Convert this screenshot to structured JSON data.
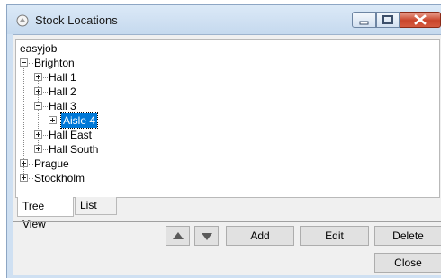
{
  "window": {
    "title": "Stock Locations"
  },
  "tree": {
    "root": "easyjob",
    "items": [
      {
        "label": "Brighton",
        "state": "expanded"
      },
      {
        "label": "Hall 1",
        "state": "collapsed"
      },
      {
        "label": "Hall 2",
        "state": "collapsed"
      },
      {
        "label": "Hall 3",
        "state": "expanded"
      },
      {
        "label": "Aisle 4",
        "state": "collapsed",
        "selected": true
      },
      {
        "label": "Hall East",
        "state": "collapsed"
      },
      {
        "label": "Hall South",
        "state": "collapsed"
      },
      {
        "label": "Prague",
        "state": "collapsed"
      },
      {
        "label": "Stockholm",
        "state": "collapsed"
      }
    ]
  },
  "tabs": [
    {
      "label": "Tree View",
      "active": true
    },
    {
      "label": "List",
      "active": false
    }
  ],
  "buttons": {
    "add": "Add",
    "edit": "Edit",
    "delete": "Delete",
    "close": "Close"
  },
  "icons": {
    "move_up": "triangle-up-icon",
    "move_down": "triangle-down-icon",
    "app": "stock-location-icon"
  },
  "colors": {
    "selection": "#0078d7",
    "close_button": "#c9452b"
  }
}
